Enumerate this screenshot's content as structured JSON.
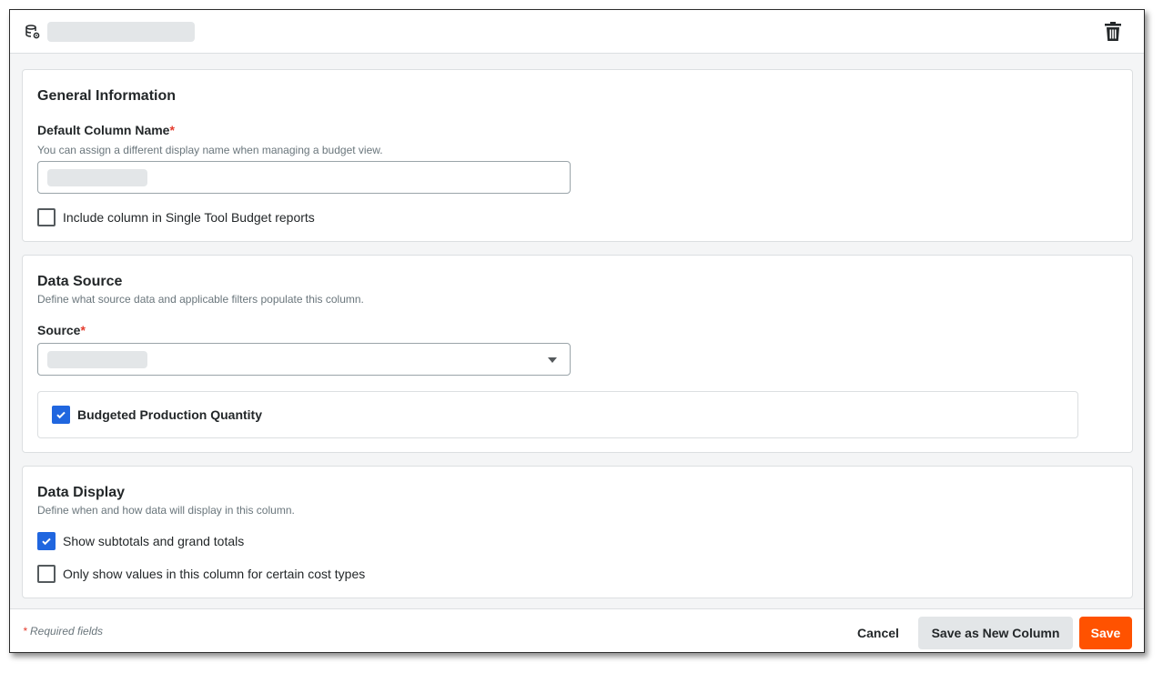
{
  "general": {
    "heading": "General Information",
    "name_label": "Default Column Name",
    "required_mark": "*",
    "name_hint": "You can assign a different display name when managing a budget view.",
    "include_label": "Include column in Single Tool Budget reports",
    "include_checked": false
  },
  "data_source": {
    "heading": "Data Source",
    "description": "Define what source data and applicable filters populate this column.",
    "source_label": "Source",
    "required_mark": "*",
    "option_label": "Budgeted Production Quantity",
    "option_checked": true
  },
  "data_display": {
    "heading": "Data Display",
    "description": "Define when and how data will display in this column.",
    "subtotals_label": "Show subtotals and grand totals",
    "subtotals_checked": true,
    "cost_types_label": "Only show values in this column for certain cost types",
    "cost_types_checked": false
  },
  "footer": {
    "required_mark": "*",
    "required_note": "Required fields",
    "cancel_label": "Cancel",
    "save_new_label": "Save as New Column",
    "save_label": "Save"
  },
  "colors": {
    "accent": "#ff5200",
    "checkbox": "#2066df",
    "required": "#e43b2d"
  },
  "icons": {
    "title": "database-settings-icon",
    "delete": "trash-icon",
    "dropdown": "chevron-down-icon",
    "check": "check-icon"
  }
}
